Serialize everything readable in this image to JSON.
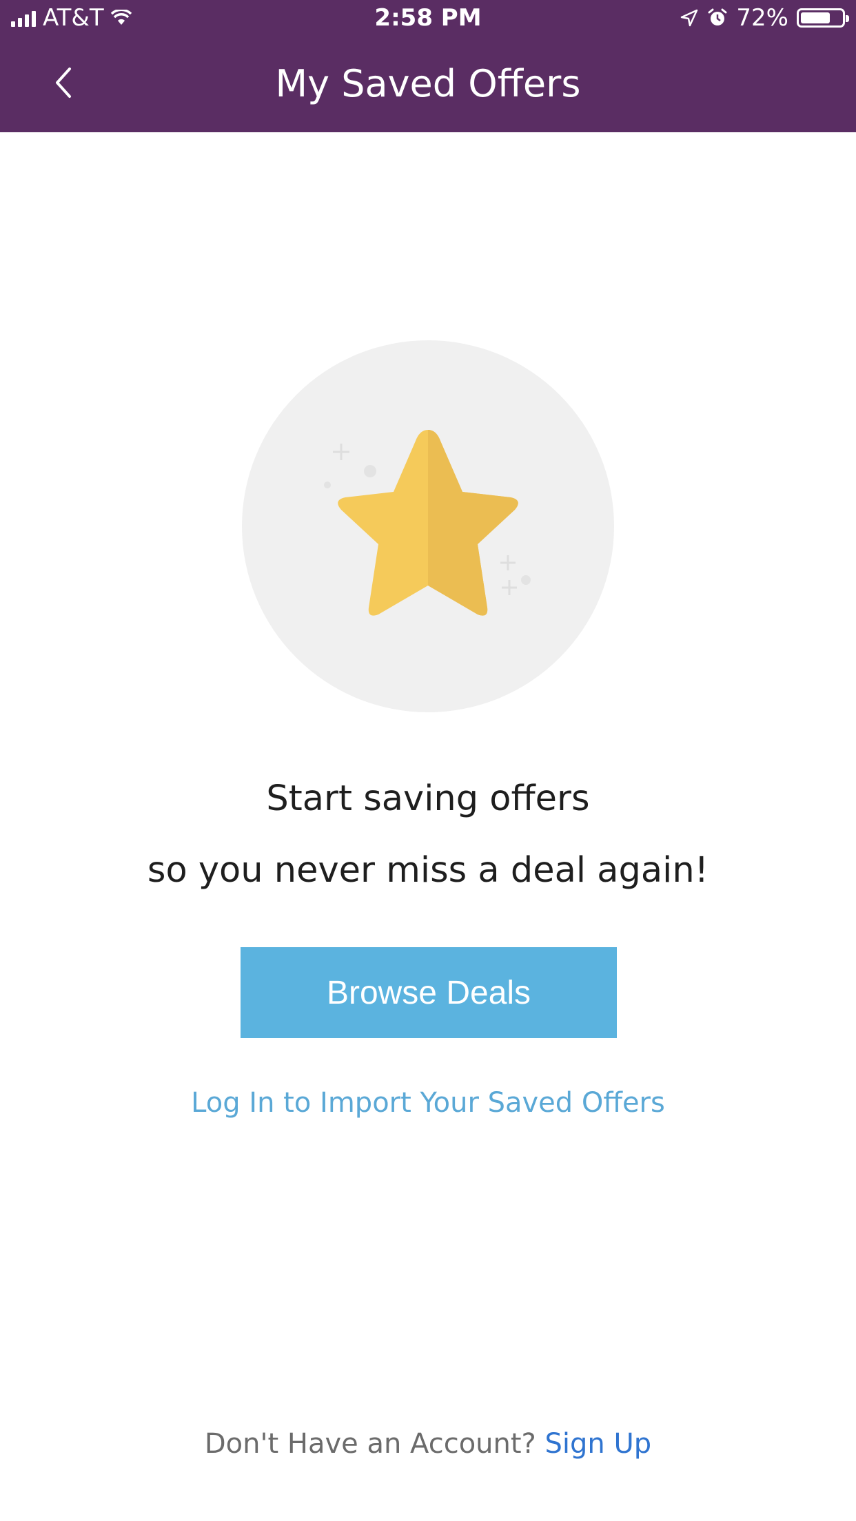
{
  "status_bar": {
    "carrier": "AT&T",
    "time": "2:58 PM",
    "battery": "72%",
    "battery_level": 0.72,
    "icons": [
      "signal-icon",
      "wifi-icon",
      "location-arrow-icon",
      "alarm-icon",
      "battery-icon"
    ]
  },
  "nav": {
    "back_icon": "chevron-left-icon",
    "title": "My Saved Offers"
  },
  "empty_state": {
    "illustration": "star-icon",
    "headline": "Start saving offers",
    "subline": "so you never miss a deal again!",
    "browse_button": "Browse Deals",
    "login_link": "Log In to Import Your Saved Offers"
  },
  "footer": {
    "prompt": "Don't Have an Account?",
    "signup_link": "Sign Up"
  },
  "colors": {
    "header_bg": "#5a2d63",
    "button_bg": "#5bb3df",
    "link_blue": "#5aa8d6",
    "signup_blue": "#2f74d0",
    "star_yellow": "#f5ca5a",
    "circle_bg": "#f0f0f0"
  }
}
